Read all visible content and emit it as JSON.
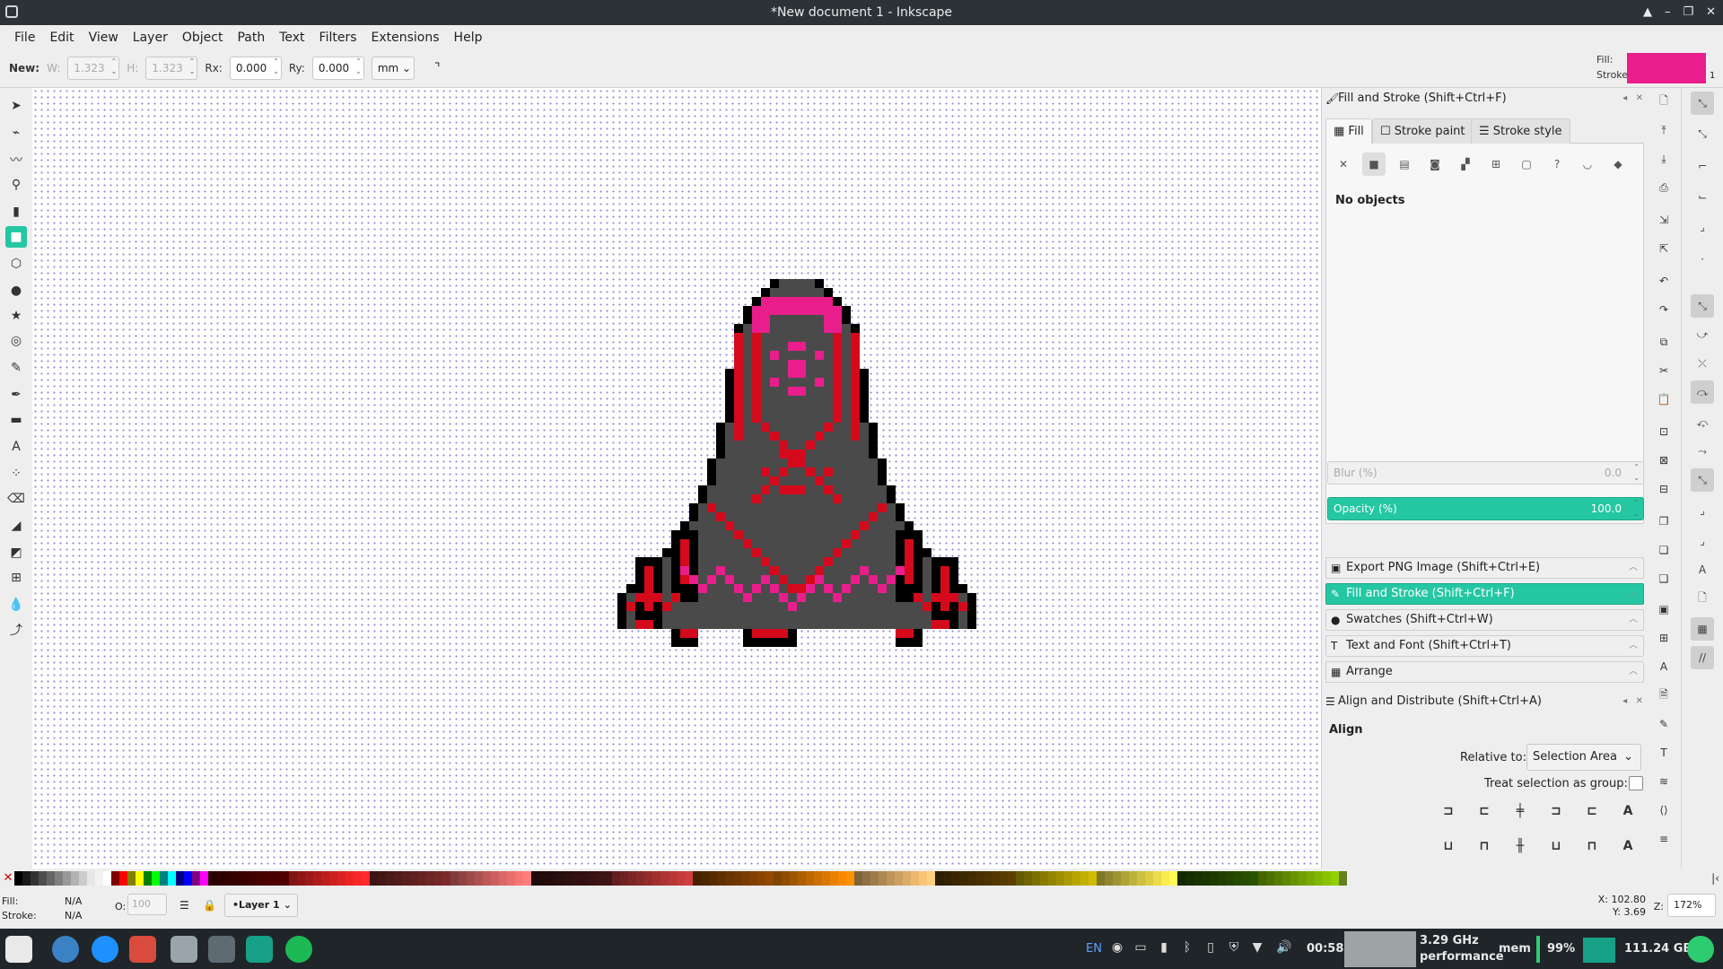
{
  "window": {
    "title": "*New document 1 - Inkscape"
  },
  "menu": [
    "File",
    "Edit",
    "View",
    "Layer",
    "Object",
    "Path",
    "Text",
    "Filters",
    "Extensions",
    "Help"
  ],
  "toolctl": {
    "new_label": "New:",
    "w_label": "W:",
    "w_value": "1.323",
    "h_label": "H:",
    "h_value": "1.323",
    "rx_label": "Rx:",
    "rx_value": "0.000",
    "ry_label": "Ry:",
    "ry_value": "0.000",
    "unit": "mm",
    "fill_label": "Fill:",
    "stroke_label": "Stroke:",
    "stroke_width": "1",
    "fill_color": "#e91e8c"
  },
  "fill_stroke": {
    "title": "Fill and Stroke (Shift+Ctrl+F)",
    "tabs": [
      "Fill",
      "Stroke paint",
      "Stroke style"
    ],
    "no_objects": "No objects",
    "blur_label": "Blur (%)",
    "blur_value": "0.0",
    "opacity_label": "Opacity (%)",
    "opacity_value": "100.0"
  },
  "collapsed_panels": [
    "Export PNG Image (Shift+Ctrl+E)",
    "Fill and Stroke (Shift+Ctrl+F)",
    "Swatches (Shift+Ctrl+W)",
    "Text and Font (Shift+Ctrl+T)",
    "Arrange"
  ],
  "align": {
    "title": "Align and Distribute (Shift+Ctrl+A)",
    "section": "Align",
    "relative_label": "Relative to:",
    "relative_value": "Selection Area",
    "group_label": "Treat selection as group:"
  },
  "status": {
    "fill_label": "Fill:",
    "fill_value": "N/A",
    "stroke_label": "Stroke:",
    "stroke_value": "N/A",
    "opacity_label": "O:",
    "opacity_value": "100",
    "layer": "•Layer 1",
    "x_label": "X:",
    "x_value": "102.80",
    "y_label": "Y:",
    "y_value": "3.69",
    "zoom_label": "Z:",
    "zoom_value": "172%"
  },
  "taskbar": {
    "lang": "EN",
    "time": "00:58",
    "cpu_freq": "3.29 GHz",
    "cpu_mode": "performance",
    "mem_label": "mem",
    "battery": "99%",
    "disk": "111.24 GB"
  },
  "colors": {
    "accent": "#25c7a3",
    "sprite_pink": "#e91e8c",
    "sprite_red": "#d40a1c",
    "sprite_gray": "#4a4a4a"
  }
}
